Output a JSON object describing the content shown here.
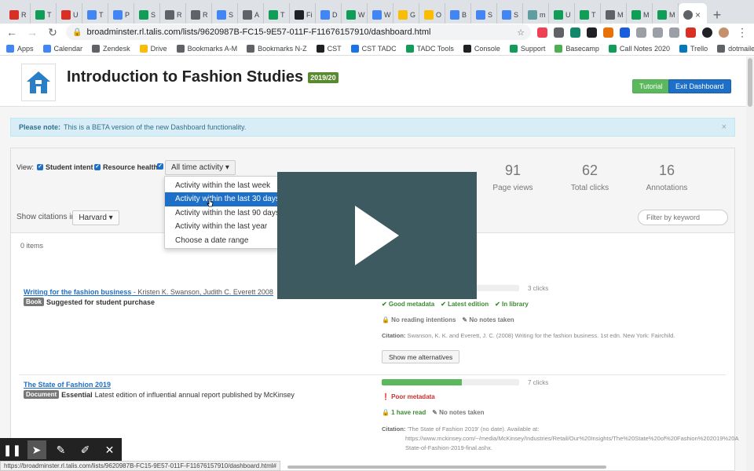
{
  "browser": {
    "tabs": [
      {
        "label": "R",
        "color": "#d93025"
      },
      {
        "label": "T",
        "color": "#0f9d58"
      },
      {
        "label": "U",
        "color": "#d93025"
      },
      {
        "label": "T",
        "color": "#4285f4"
      },
      {
        "label": "P",
        "color": "#4285f4"
      },
      {
        "label": "S",
        "color": "#0f9d58"
      },
      {
        "label": "R",
        "color": "#5f6368"
      },
      {
        "label": "R",
        "color": "#5f6368"
      },
      {
        "label": "S",
        "color": "#4285f4"
      },
      {
        "label": "A",
        "color": "#5f6368"
      },
      {
        "label": "T",
        "color": "#0f9d58"
      },
      {
        "label": "Fi",
        "color": "#202124"
      },
      {
        "label": "D",
        "color": "#4285f4"
      },
      {
        "label": "W",
        "color": "#0f9d58"
      },
      {
        "label": "W",
        "color": "#4285f4"
      },
      {
        "label": "G",
        "color": "#fbbc04"
      },
      {
        "label": "O",
        "color": "#fbbc04"
      },
      {
        "label": "B",
        "color": "#4285f4"
      },
      {
        "label": "S",
        "color": "#4285f4"
      },
      {
        "label": "S",
        "color": "#4285f4"
      },
      {
        "label": "m",
        "color": "#5f9ea0"
      },
      {
        "label": "U",
        "color": "#0f9d58"
      },
      {
        "label": "T",
        "color": "#0f9d58"
      },
      {
        "label": "M",
        "color": "#5f6368"
      },
      {
        "label": "M",
        "color": "#0f9d58"
      },
      {
        "label": "M",
        "color": "#0f9d58"
      }
    ],
    "new_tab": "+",
    "close_tab": "×",
    "url": "broadminster.rl.talis.com/lists/9620987B-FC15-9E57-011F-F11676157910/dashboard.html",
    "bookmarks": [
      {
        "label": "Apps",
        "color": "#4285f4"
      },
      {
        "label": "Calendar",
        "color": "#4285f4"
      },
      {
        "label": "Zendesk",
        "color": "#5f6368"
      },
      {
        "label": "Drive",
        "color": "#fbbc04"
      },
      {
        "label": "Bookmarks A-M",
        "color": "#5f6368"
      },
      {
        "label": "Bookmarks N-Z",
        "color": "#5f6368"
      },
      {
        "label": "CST",
        "color": "#202124"
      },
      {
        "label": "CST TADC",
        "color": "#1a73e8"
      },
      {
        "label": "TADC Tools",
        "color": "#0f9d58"
      },
      {
        "label": "Console",
        "color": "#202124"
      },
      {
        "label": "Support",
        "color": "#0f9d58"
      },
      {
        "label": "Basecamp",
        "color": "#4caf50"
      },
      {
        "label": "Call Notes 2020",
        "color": "#0f9d58"
      },
      {
        "label": "Trello",
        "color": "#0079bf"
      },
      {
        "label": "dotmailer",
        "color": "#5f6368"
      }
    ],
    "bookmarks_more": "»",
    "status_url": "https://broadminster.rl.talis.com/lists/9620987B-FC15-9E57-011F-F11676157910/dashboard.html#"
  },
  "header": {
    "title": "Introduction to Fashion Studies",
    "year_badge": "2019/20",
    "tutorial_label": "Tutorial",
    "exit_label": "Exit Dashboard"
  },
  "beta": {
    "label": "Please note:",
    "text": "This is a BETA version of the new Dashboard functionality.",
    "close": "×"
  },
  "filters": {
    "view_label": "View:",
    "student_intent": "Student intent",
    "resource_health": "Resource health",
    "range_label": "All time activity ▾",
    "citations_label": "Show citations in",
    "citation_style": "Harvard ▾",
    "keyword_placeholder": "Filter by keyword"
  },
  "stats": [
    {
      "num": "91",
      "label": "Page views"
    },
    {
      "num": "62",
      "label": "Total clicks"
    },
    {
      "num": "16",
      "label": "Annotations"
    }
  ],
  "dropdown_menu": {
    "items": [
      "Activity within the last week",
      "Activity within the last 30 days",
      "Activity within the last 90 days",
      "Activity within the last year",
      "Choose a date range"
    ],
    "highlighted_index": 1
  },
  "list": {
    "count": "0 items",
    "items": [
      {
        "title": "Writing for the fashion business",
        "authors": " - Kristen K. Swanson, Judith C. Everett 2008",
        "type": "Book",
        "note": "Suggested for student purchase",
        "bar": 0.25,
        "clicks": "3 clicks",
        "metadata": [
          "✔ Good metadata",
          "✔ Latest edition",
          "✔ In library"
        ],
        "intent": [
          "🔒 No reading intentions",
          "✎ No notes taken"
        ],
        "citation_label": "Citation:",
        "citation": "Swanson, K. K. and Everett, J. C. (2008) Writing for the fashion business. 1st edn. New York: Fairchild.",
        "alt_label": "Show me alternatives"
      },
      {
        "title": "The State of Fashion 2019",
        "authors": "",
        "type": "Document",
        "note": "Essential",
        "note_extra": "Latest edition of influential annual report published by McKinsey",
        "bar": 0.58,
        "clicks": "7 clicks",
        "metadata": [
          "❗ Poor metadata"
        ],
        "intent": [
          "🔒 1 have read",
          "✎ No notes taken"
        ],
        "citation_label": "Citation:",
        "citation": "'The State of Fashion 2019' (no date). Available at:",
        "citation_line2": "https://www.mckinsey.com/~/media/McKinsey/Industries/Retail/Our%20Insights/The%20State%20of%20Fashion%202019%20A",
        "citation_line3": "State-of-Fashion-2019-final.ashx."
      }
    ]
  },
  "annotation_toolbar": [
    "pause",
    "pointer",
    "pen",
    "highlighter",
    "close"
  ]
}
